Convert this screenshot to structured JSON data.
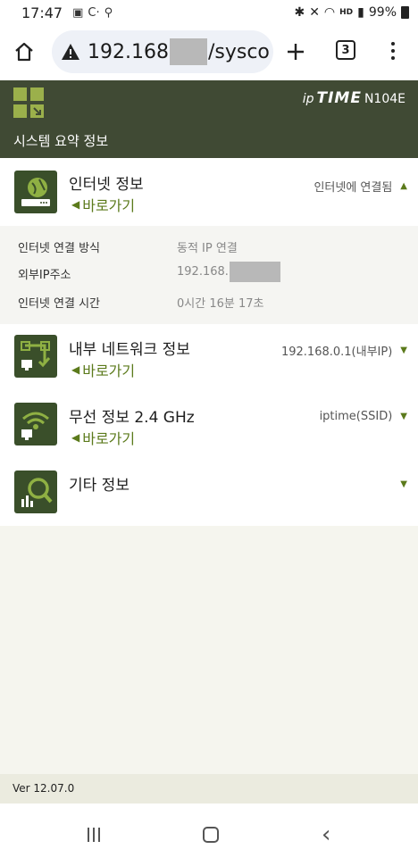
{
  "status_bar": {
    "time": "17:47",
    "battery": "99%"
  },
  "browser": {
    "url_prefix": "192.168",
    "url_suffix": "/sysco",
    "tab_count": "3"
  },
  "header": {
    "brand_ip": "ip",
    "brand_time": "TIME",
    "model": "N104E",
    "title": "시스템 요약 정보"
  },
  "sections": [
    {
      "title": "인터넷 정보",
      "link": "바로가기",
      "status": "인터넷에 연결됨",
      "expanded": true,
      "details": [
        {
          "label": "인터넷 연결 방식",
          "value": "동적 IP 연결"
        },
        {
          "label": "외부IP주소",
          "value": "192.168."
        },
        {
          "label": "인터넷 연결 시간",
          "value": "0시간 16분 17초"
        }
      ]
    },
    {
      "title": "내부 네트워크 정보",
      "link": "바로가기",
      "status": "192.168.0.1(내부IP)",
      "expanded": false
    },
    {
      "title": "무선 정보 2.4 GHz",
      "link": "바로가기",
      "status": "iptime(SSID)",
      "expanded": false
    },
    {
      "title": "기타 정보",
      "expanded": false
    }
  ],
  "footer": {
    "version": "Ver 12.07.0"
  },
  "colors": {
    "header_bg": "#404a34",
    "accent_green": "#5b7a1b",
    "logo_green": "#9bb04b",
    "icon_bg": "#3a4f2a"
  }
}
